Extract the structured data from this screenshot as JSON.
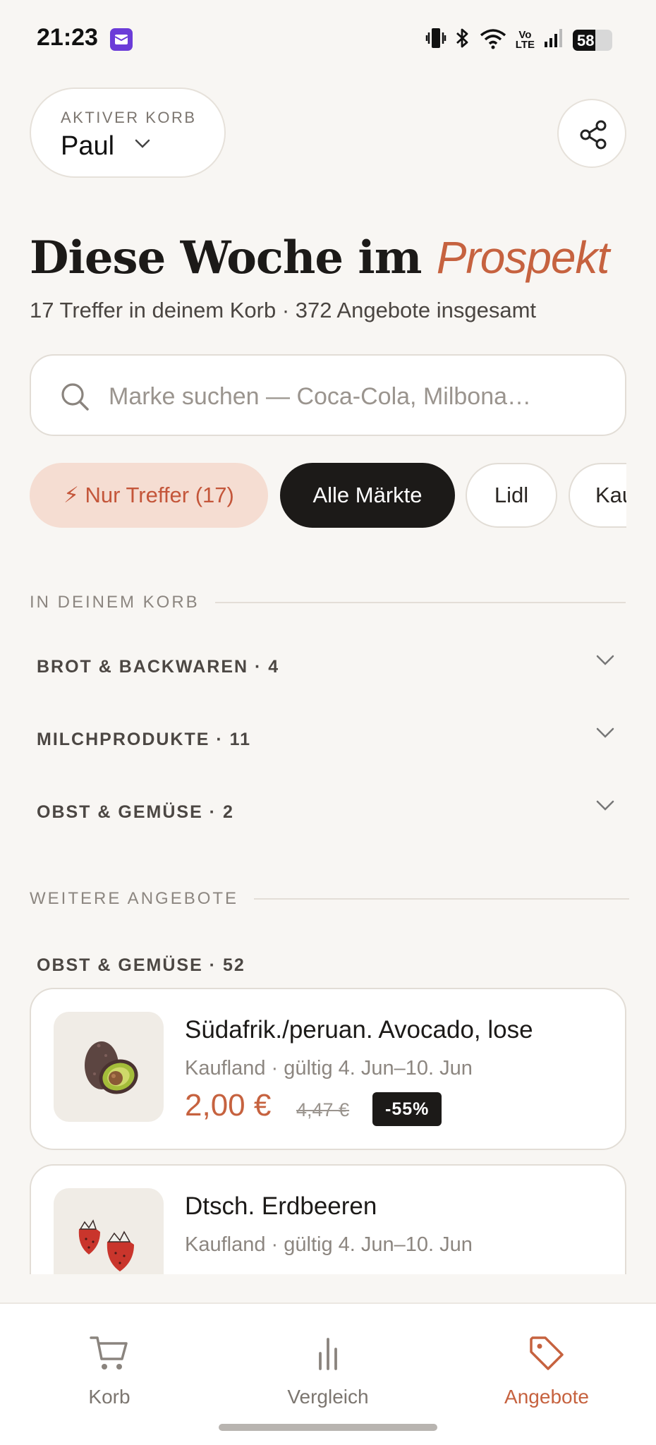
{
  "status_bar": {
    "time": "21:23",
    "volte_top": "Vo",
    "volte_bottom": "LTE",
    "battery": "58",
    "battery_level": 0.58
  },
  "header": {
    "basket_caption": "AKTIVER KORB",
    "basket_name": "Paul"
  },
  "hero": {
    "title_main": "Diese Woche im",
    "title_accent": "Prospekt",
    "subtitle": "17 Treffer in deinem Korb · 372 Angebote insgesamt"
  },
  "search": {
    "placeholder": "Marke suchen — Coca-Cola, Milbona…",
    "value": ""
  },
  "filters": {
    "treffer_label": "⚡ Nur Treffer (17)",
    "all_markets_label": "Alle Märkte",
    "lidl_label": "Lidl",
    "kaufland_label": "Kau"
  },
  "in_basket": {
    "heading": "IN DEINEM KORB",
    "categories": [
      {
        "label": "BROT & BACKWAREN · 4"
      },
      {
        "label": "MILCHPRODUKTE · 11"
      },
      {
        "label": "OBST & GEMÜSE · 2"
      }
    ]
  },
  "more_offers": {
    "heading": "WEITERE ANGEBOTE",
    "category": "OBST & GEMÜSE · 52",
    "offers": [
      {
        "name": "Südafrik./peruan. Avocado, lose",
        "meta": "Kaufland · gültig 4. Jun–10. Jun",
        "price": "2,00 €",
        "old_price": "4,47 €",
        "discount": "-55%",
        "icon": "avocado-icon"
      },
      {
        "name": "Dtsch. Erdbeeren",
        "meta": "Kaufland · gültig 4. Jun–10. Jun",
        "icon": "strawberry-icon"
      }
    ]
  },
  "bottom_nav": {
    "korb": "Korb",
    "vergleich": "Vergleich",
    "angebote": "Angebote",
    "active": "angebote"
  },
  "colors": {
    "accent": "#c6623f",
    "background": "#f8f6f3",
    "chip_active": "#1c1a18",
    "chip_treffer_bg": "#f5ddd2"
  }
}
